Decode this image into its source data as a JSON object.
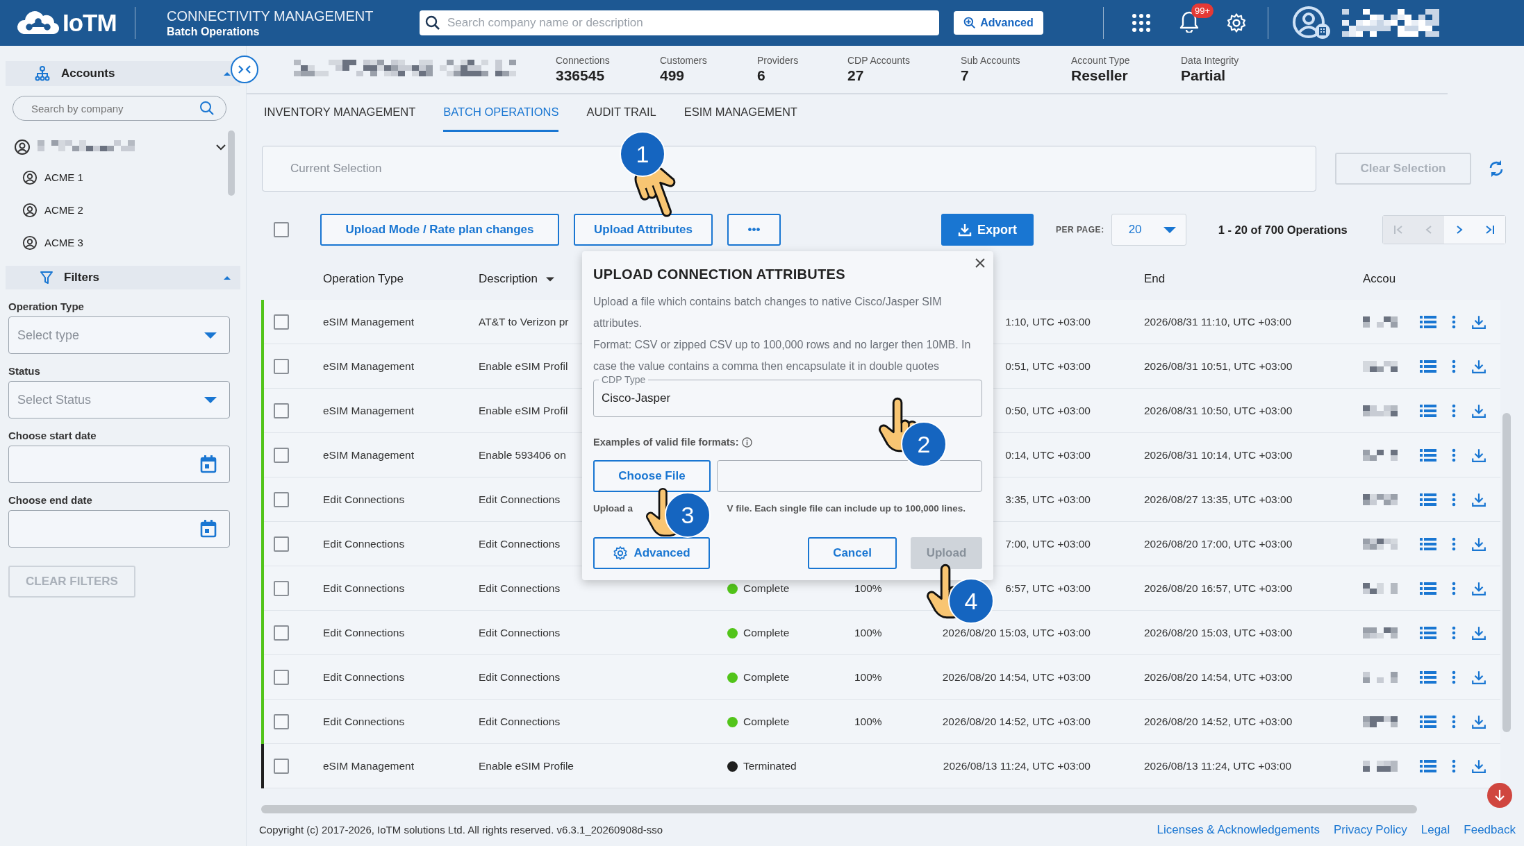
{
  "header": {
    "logo": "IoTM",
    "title": "CONNECTIVITY MANAGEMENT",
    "subtitle": "Batch Operations",
    "search_placeholder": "Search company name or description",
    "advanced_button": "Advanced",
    "notification_badge": "99+"
  },
  "sidebar": {
    "accounts": {
      "title": "Accounts",
      "expanded": true
    },
    "search_placeholder": "Search by company",
    "tree": {
      "expanded": true,
      "children": [
        {
          "label": "ACME 1"
        },
        {
          "label": "ACME 2"
        },
        {
          "label": "ACME 3"
        }
      ]
    },
    "filters": {
      "title": "Filters",
      "expanded": true,
      "fields": [
        {
          "kind": "select",
          "label": "Operation Type",
          "placeholder": "Select type"
        },
        {
          "kind": "select",
          "label": "Status",
          "placeholder": "Select Status"
        },
        {
          "kind": "date",
          "label": "Choose start date"
        },
        {
          "kind": "date",
          "label": "Choose end date"
        }
      ],
      "clear_button": {
        "label": "CLEAR FILTERS",
        "disabled": true
      }
    }
  },
  "stats": [
    {
      "label": "Connections",
      "value": "336545"
    },
    {
      "label": "Customers",
      "value": "499"
    },
    {
      "label": "Providers",
      "value": "6"
    },
    {
      "label": "CDP Accounts",
      "value": "27"
    },
    {
      "label": "Sub Accounts",
      "value": "7"
    },
    {
      "label": "Account Type",
      "value": "Reseller"
    },
    {
      "label": "Data Integrity",
      "value": "Partial"
    }
  ],
  "tabs": [
    {
      "label": "INVENTORY MANAGEMENT",
      "selected": false
    },
    {
      "label": "BATCH OPERATIONS",
      "selected": true
    },
    {
      "label": "AUDIT TRAIL",
      "selected": false
    },
    {
      "label": "ESIM MANAGEMENT",
      "selected": false
    }
  ],
  "selection": {
    "placeholder": "Current Selection",
    "clear_button": {
      "label": "Clear Selection",
      "disabled": true
    }
  },
  "toolbar": {
    "select_all": {
      "checked": false
    },
    "buttons": [
      "Upload Mode / Rate plan changes",
      "Upload Attributes",
      "•••"
    ],
    "export": "Export",
    "per_page_label": "PER PAGE:",
    "per_page": "20",
    "range": "1 - 20 of 700 Operations",
    "pagination": [
      {
        "kind": "first",
        "disabled": true
      },
      {
        "kind": "prev",
        "disabled": true
      },
      {
        "kind": "next",
        "disabled": false
      },
      {
        "kind": "last",
        "disabled": false
      }
    ]
  },
  "table": {
    "columns": [
      {
        "label": "Operation Type",
        "sorted": false
      },
      {
        "label": "Description",
        "sorted": true
      },
      {
        "label": "End",
        "sorted": false
      },
      {
        "label": "Accou",
        "sorted": false
      }
    ],
    "rows": [
      {
        "checked": false,
        "color": "#52c41a",
        "operation_type": "eSIM Management",
        "description": "AT&T to Verizon pr",
        "start": "1:10, UTC +03:00",
        "end": "2026/08/31 11:10, UTC +03:00"
      },
      {
        "checked": false,
        "color": "#52c41a",
        "operation_type": "eSIM Management",
        "description": "Enable eSIM Profil",
        "start": "0:51, UTC +03:00",
        "end": "2026/08/31 10:51, UTC +03:00"
      },
      {
        "checked": false,
        "color": "#52c41a",
        "operation_type": "eSIM Management",
        "description": "Enable eSIM Profil",
        "start": "0:50, UTC +03:00",
        "end": "2026/08/31 10:50, UTC +03:00"
      },
      {
        "checked": false,
        "color": "#52c41a",
        "operation_type": "eSIM Management",
        "description": "Enable 593406 on",
        "start": "0:14, UTC +03:00",
        "end": "2026/08/31 10:14, UTC +03:00"
      },
      {
        "checked": false,
        "color": "#52c41a",
        "operation_type": "Edit Connections",
        "description": "Edit Connections",
        "start": "3:35, UTC +03:00",
        "end": "2026/08/27 13:35, UTC +03:00"
      },
      {
        "checked": false,
        "color": "#52c41a",
        "operation_type": "Edit Connections",
        "description": "Edit Connections",
        "start": "7:00, UTC +03:00",
        "end": "2026/08/20 17:00, UTC +03:00"
      },
      {
        "checked": false,
        "color": "#52c41a",
        "operation_type": "Edit Connections",
        "description": "Edit Connections",
        "status": "Complete",
        "progress": "100%",
        "start": "6:57, UTC +03:00",
        "end": "2026/08/20 16:57, UTC +03:00"
      },
      {
        "checked": false,
        "color": "#52c41a",
        "operation_type": "Edit Connections",
        "description": "Edit Connections",
        "status": "Complete",
        "progress": "100%",
        "start": "2026/08/20 15:03, UTC +03:00",
        "end": "2026/08/20 15:03, UTC +03:00"
      },
      {
        "checked": false,
        "color": "#52c41a",
        "operation_type": "Edit Connections",
        "description": "Edit Connections",
        "status": "Complete",
        "progress": "100%",
        "start": "2026/08/20 14:54, UTC +03:00",
        "end": "2026/08/20 14:54, UTC +03:00"
      },
      {
        "checked": false,
        "color": "#52c41a",
        "operation_type": "Edit Connections",
        "description": "Edit Connections",
        "status": "Complete",
        "progress": "100%",
        "start": "2026/08/20 14:52, UTC +03:00",
        "end": "2026/08/20 14:52, UTC +03:00"
      },
      {
        "checked": false,
        "color": "#1f1f1f",
        "operation_type": "eSIM Management",
        "description": "Enable eSIM Profile",
        "status": "Terminated",
        "start": "2026/08/13 11:24, UTC +03:00",
        "end": "2026/08/13 11:24, UTC +03:00"
      }
    ]
  },
  "modal": {
    "title": "UPLOAD CONNECTION ATTRIBUTES",
    "paragraphs": [
      "Upload a file which contains batch changes to native Cisco/Jasper SIM attributes.",
      "Format: CSV or zipped CSV up to 100,000 rows and no larger then 10MB. In case the value contains a comma then encapsulate it in double quotes"
    ],
    "cdp_field": {
      "label": "CDP Type",
      "value": "Cisco-Jasper"
    },
    "examples_label": "Examples of valid file formats:",
    "choose_button": "Choose File",
    "hint_parts": [
      "Upload a",
      "V file. Each single file can include up to 100,000 lines."
    ],
    "buttons": [
      {
        "kind": "advanced",
        "label": "Advanced",
        "disabled": false
      },
      {
        "kind": "cancel",
        "label": "Cancel",
        "disabled": false
      },
      {
        "kind": "upload",
        "label": "Upload",
        "disabled": true
      }
    ]
  },
  "annotations": [
    {
      "number": "1"
    },
    {
      "number": "2"
    },
    {
      "number": "3"
    },
    {
      "number": "4"
    }
  ],
  "footer": {
    "copyright": "Copyright (c) 2017-2026, IoTM solutions Ltd. All rights reserved. v6.3.1_20260908d-sso",
    "links": [
      "Licenses & Acknowledgements",
      "Privacy Policy",
      "Legal",
      "Feedback"
    ]
  }
}
